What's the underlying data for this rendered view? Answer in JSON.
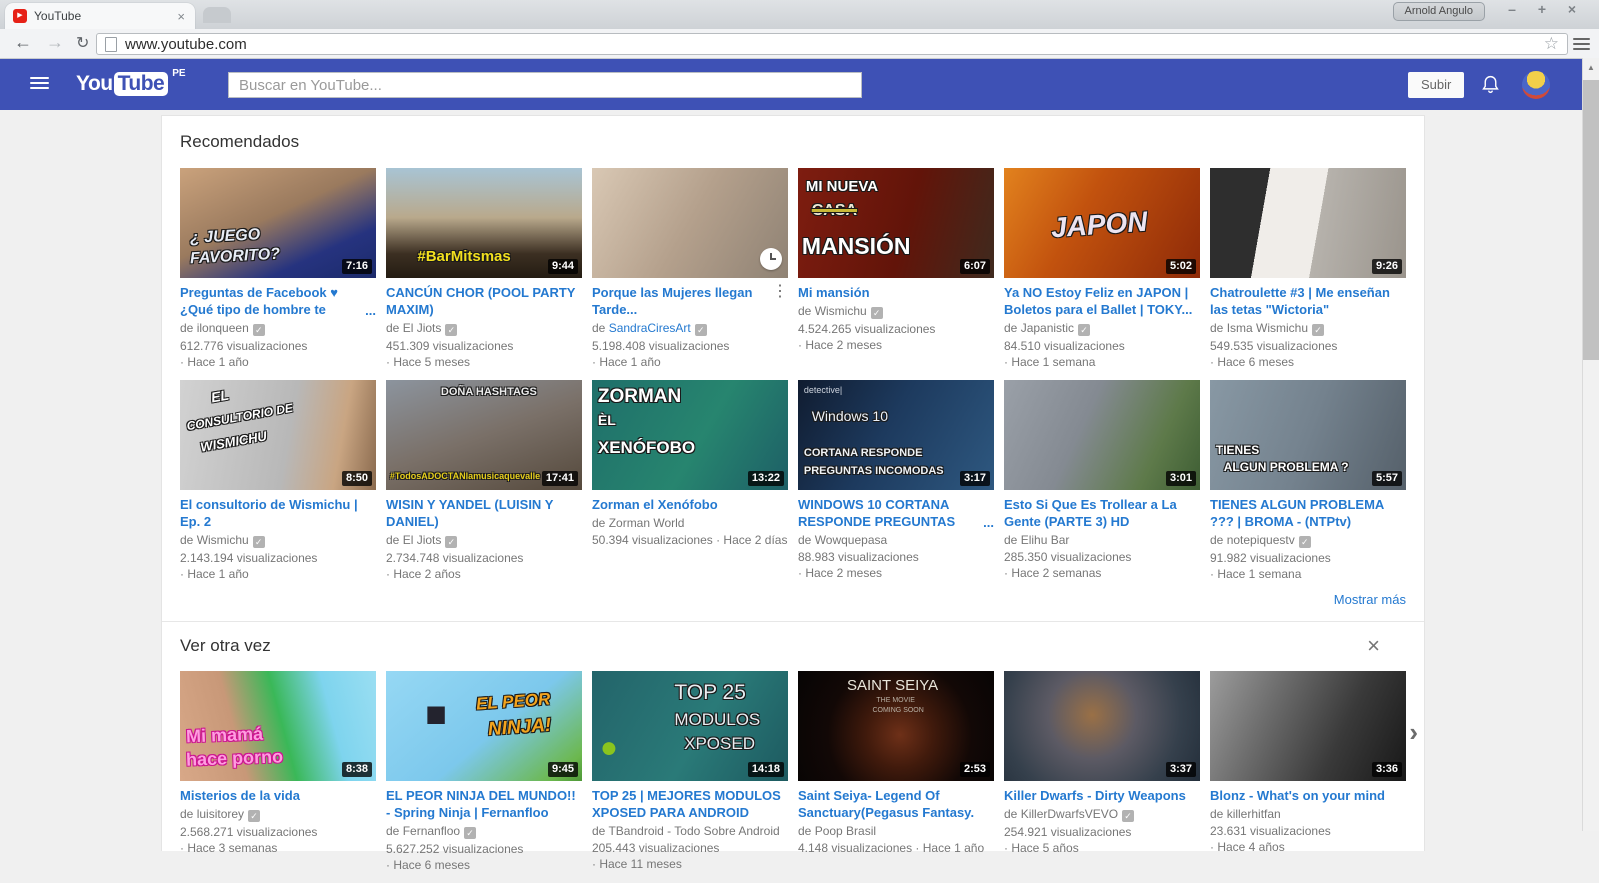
{
  "browser": {
    "tab_title": "YouTube",
    "url": "www.youtube.com",
    "profile_name": "Arnold Angulo"
  },
  "icons": {
    "play": "▶",
    "tab_close": "×",
    "win_min": "–",
    "win_max": "+",
    "win_close": "×",
    "back": "←",
    "forward": "→",
    "refresh": "↻",
    "star": "☆",
    "check": "✓",
    "dots_vertical": "⋮",
    "ellipsis": "...",
    "close": "×",
    "chevron_right": "›",
    "scroll_up": "▲"
  },
  "labels": {
    "by": "de"
  },
  "header": {
    "logo_you": "You",
    "logo_tube": "Tube",
    "country": "PE",
    "search_placeholder": "Buscar en YouTube...",
    "upload_label": "Subir"
  },
  "colors": {
    "header_blue": "#3e51b5",
    "link_blue": "#2479d0",
    "meta_gray": "#767676",
    "page_bg": "#f0f0f0"
  },
  "sections": [
    {
      "title": "Recomendados",
      "show_more": "Mostrar más",
      "videos": [
        {
          "title": "Preguntas de Facebook ♥ ¿Qué tipo de hombre te",
          "channel": "ilonqueen",
          "verified": true,
          "views": "612.776 visualizaciones",
          "age": "Hace 1 año",
          "duration": "7:16",
          "menu": "h",
          "thumb": {
            "bg": "linear-gradient(155deg,#caa27c 0%,#9a7a5e 45%,#26337f 75%,#1b2a6b 100%)",
            "ov": [
              [
                "¿ JUEGO",
                5,
                55,
                16,
                "#e8edf6",
                700,
                1,
                1,
                -3
              ],
              [
                "FAVORITO?",
                5,
                74,
                16,
                "#e8edf6",
                700,
                1,
                1,
                -3
              ]
            ]
          }
        },
        {
          "title": "CANCÚN CHOR (POOL PARTY MAXIM)",
          "channel": "El Jiots",
          "verified": true,
          "views": "451.309 visualizaciones",
          "age": "Hace 5 meses",
          "duration": "9:44",
          "thumb": {
            "bg": "linear-gradient(180deg,#a8c4d4 0%,#b9a98c 45%,#3c2f22 78%,#241c12 100%)",
            "ov": [
              [
                "#BarMitsmas",
                16,
                74,
                15,
                "#f2df1e",
                800,
                0,
                1,
                0
              ]
            ]
          }
        },
        {
          "title": "Porque las Mujeres llegan Tarde...",
          "channel": "SandraCiresArt",
          "verified": true,
          "hl": true,
          "views": "5.198.408 visualizaciones",
          "age": "Hace 1 año",
          "menu": "v",
          "watch_later": true,
          "thumb": {
            "bg": "linear-gradient(120deg,#d9c8b4 0%,#b4a08c 50%,#8f8274 100%)",
            "ov": []
          }
        },
        {
          "title": "Mi mansión",
          "channel": "Wismichu",
          "verified": true,
          "views": "4.524.265 visualizaciones",
          "age": "Hace 2 meses",
          "duration": "6:07",
          "thumb": {
            "bg": "linear-gradient(105deg,#7e1d10 0%,#621409 55%,#3f2a1e 100%)",
            "ov": [
              [
                "MI NUEVA",
                4,
                10,
                15,
                "#ffffff",
                800,
                0,
                1,
                0
              ],
              [
                "CASA",
                7,
                32,
                16,
                "#efe8d4",
                800,
                0,
                1,
                0,
                1
              ],
              [
                "MANSIÓN",
                2,
                60,
                23,
                "#ffffff",
                800,
                0,
                1,
                0
              ]
            ]
          }
        },
        {
          "title": "Ya NO Estoy Feliz en JAPON | Boletos para el Ballet | TOKY...",
          "channel": "Japanistic",
          "verified": true,
          "views": "84.510 visualizaciones",
          "age": "Hace 1 semana",
          "duration": "5:02",
          "thumb": {
            "bg": "linear-gradient(120deg,#e2821e 0%,#c2520e 40%,#8e2a08 100%)",
            "ov": [
              [
                "JAPON",
                24,
                38,
                28,
                "#ece4f0",
                800,
                1,
                1,
                -4
              ]
            ]
          }
        },
        {
          "title": "Chatroulette #3 | Me enseñan las tetas \"Wictoria\"",
          "channel": "Isma Wismichu",
          "verified": true,
          "views": "549.535 visualizaciones",
          "age": "Hace 6 meses",
          "duration": "9:26",
          "thumb": {
            "bg": "linear-gradient(100deg,#2e2e2e 0%,#2e2e2e 28%,#f0ede9 28%,#f0ede9 55%,#b6b2ac 55%,#9a948c 100%)",
            "ov": []
          }
        },
        {
          "title": "El consultorio de Wismichu | Ep. 2",
          "channel": "Wismichu",
          "verified": true,
          "views": "2.143.194 visualizaciones",
          "age": "Hace 1 año",
          "duration": "8:50",
          "thumb": {
            "bg": "linear-gradient(100deg,#d2d2d2 0%,#b8b8b8 55%,#c9a582 80%,#8a6a4e 100%)",
            "ov": [
              [
                "EL",
                16,
                8,
                14,
                "#ffffff",
                800,
                1,
                1,
                -10
              ],
              [
                "CONSULTORIO DE",
                3,
                28,
                12,
                "#ffffff",
                800,
                1,
                1,
                -10
              ],
              [
                "WISMICHU",
                10,
                50,
                13,
                "#ffffff",
                800,
                1,
                1,
                -10
              ]
            ]
          }
        },
        {
          "title": "WISIN Y YANDEL (LUISIN Y DANIEL)",
          "channel": "El Jiots",
          "verified": true,
          "views": "2.734.748 visualizaciones",
          "age": "Hace 2 años",
          "duration": "17:41",
          "thumb": {
            "bg": "linear-gradient(160deg,#8c949e 0%,#7a7068 50%,#55493c 100%)",
            "ov": [
              [
                "DOÑA HASHTAGS",
                28,
                6,
                11,
                "#ececec",
                800,
                0,
                1,
                0
              ],
              [
                "#TodosADOCTANlamusicaquevalle",
                2,
                84,
                9,
                "#e6ce1c",
                700,
                0,
                1,
                0
              ]
            ]
          }
        },
        {
          "title": "Zorman el Xenófobo",
          "channel": "Zorman World",
          "verified": false,
          "views": "50.394 visualizaciones",
          "age": "Hace 2 días",
          "duration": "13:22",
          "thumb": {
            "bg": "linear-gradient(120deg,#1f6f6a 0%,#27856f 55%,#1d5f66 100%)",
            "ov": [
              [
                "ZORMAN",
                3,
                6,
                19,
                "#ffffff",
                800,
                0,
                1,
                0
              ],
              [
                "ÈL",
                3,
                30,
                14,
                "#ffffff",
                800,
                0,
                1,
                0
              ],
              [
                "XENÓFOBO",
                3,
                54,
                17,
                "#ffffff",
                800,
                0,
                1,
                0
              ]
            ]
          }
        },
        {
          "title": "WINDOWS 10 CORTANA RESPONDE PREGUNTAS",
          "channel": "Wowquepasa",
          "verified": false,
          "views": "88.983 visualizaciones",
          "age": "Hace 2 meses",
          "duration": "3:17",
          "menu": "h",
          "thumb": {
            "bg": "linear-gradient(120deg,#101c30 0%,#1d3a5e 45%,#2e5880 100%)",
            "ov": [
              [
                "detective|",
                3,
                5,
                9,
                "#cdd3dd",
                400,
                0,
                0,
                0
              ],
              [
                "Windows 10",
                7,
                26,
                14,
                "#eef2f8",
                400,
                0,
                1,
                0
              ],
              [
                "CORTANA RESPONDE",
                3,
                62,
                11,
                "#eef2f6",
                800,
                0,
                1,
                0
              ],
              [
                "PREGUNTAS INCOMODAS",
                3,
                78,
                11,
                "#eef2f6",
                800,
                0,
                1,
                0
              ]
            ]
          }
        },
        {
          "title": "Esto Si Que Es Trollear a La Gente (PARTE 3) HD",
          "channel": "Elihu Bar",
          "verified": false,
          "views": "285.350 visualizaciones",
          "age": "Hace 2 semanas",
          "duration": "3:01",
          "thumb": {
            "bg": "linear-gradient(115deg,#9aa0a8 0%,#848a92 40%,#5e7a4a 75%,#3e5e34 100%)",
            "ov": []
          }
        },
        {
          "title": "TIENES ALGUN PROBLEMA ??? | BROMA - (NTPtv)",
          "channel": "notepiquestv",
          "verified": true,
          "views": "91.982 visualizaciones",
          "age": "Hace 1 semana",
          "duration": "5:57",
          "thumb": {
            "bg": "linear-gradient(110deg,#8898a4 0%,#74828e 50%,#55606a 100%)",
            "ov": [
              [
                "TIENES",
                3,
                58,
                12,
                "#ffffff",
                800,
                0,
                1,
                0
              ],
              [
                "ALGUN PROBLEMA ?",
                7,
                74,
                12,
                "#ffffff",
                800,
                0,
                1,
                0
              ]
            ]
          }
        }
      ]
    },
    {
      "title": "Ver otra vez",
      "videos": [
        {
          "title": "Misterios de la vida",
          "channel": "luisitorey",
          "verified": true,
          "views": "2.568.271 visualizaciones",
          "age": "Hace 3 semanas",
          "duration": "8:38",
          "thumb": {
            "bg": "linear-gradient(75deg,#d8a888 0%,#c89878 30%,#3ab858 52%,#7ed4ee 75%,#9adef2 100%)",
            "ov": [
              [
                "Mi mamá",
                3,
                50,
                18,
                "#ff9ce0",
                800,
                0,
                "#cc1690",
                -2
              ],
              [
                "hace porno",
                3,
                71,
                18,
                "#ff9ce0",
                800,
                0,
                "#cc1690",
                -2
              ]
            ]
          }
        },
        {
          "title": "EL PEOR NINJA DEL MUNDO!! - Spring Ninja | Fernanfloo",
          "channel": "Fernanfloo",
          "verified": true,
          "views": "5.627.252 visualizaciones",
          "age": "Hace 6 meses",
          "duration": "9:45",
          "thumb": {
            "bg": "linear-gradient(140deg,#96d8f4 0%,#7cc8ec 55%,#6cb84e 90%,#4e9838 100%)",
            "ov": [
              [
                "■",
                20,
                22,
                36,
                "#23232e",
                400,
                0,
                0,
                0
              ],
              [
                "EL PEOR",
                46,
                20,
                17,
                "#f2a41e",
                800,
                1,
                1,
                -4
              ],
              [
                "NINJA!",
                52,
                43,
                19,
                "#f2a41e",
                800,
                1,
                1,
                -4
              ]
            ]
          }
        },
        {
          "title": "TOP 25 | MEJORES MODULOS XPOSED PARA ANDROID",
          "channel": "TBandroid - Todo Sobre Android",
          "verified": false,
          "views": "205.443 visualizaciones",
          "age": "Hace 11 meses",
          "duration": "14:18",
          "thumb": {
            "bg": "linear-gradient(120deg,#23646a 0%,#2a7a78 55%,#1d5a60 100%)",
            "ov": [
              [
                "●",
                4,
                55,
                30,
                "#8ac41e",
                400,
                0,
                0,
                0
              ],
              [
                "TOP 25",
                42,
                10,
                21,
                "#e9edf1",
                400,
                0,
                1,
                0
              ],
              [
                "MODULOS",
                42,
                36,
                17,
                "#e9edf1",
                400,
                0,
                1,
                0
              ],
              [
                "XPOSED",
                47,
                58,
                17,
                "#e9edf1",
                400,
                0,
                1,
                0
              ]
            ]
          }
        },
        {
          "title": "Saint Seiya- Legend Of Sanctuary(Pegasus Fantasy.",
          "channel": "Poop Brasil",
          "verified": false,
          "views": "4.148 visualizaciones",
          "age": "Hace 1 año",
          "duration": "2:53",
          "thumb": {
            "bg": "radial-gradient(circle at 52% 58%,#6e3018 0%,#401a0c 28%,#120806 60%,#060404 100%)",
            "ov": [
              [
                "SAINT SEIYA",
                25,
                6,
                15,
                "#e9e5da",
                400,
                0,
                0,
                0
              ],
              [
                "THE MOVIE",
                40,
                24,
                7,
                "#b9b1a5",
                400,
                0,
                0,
                0
              ],
              [
                "COMING SOON",
                38,
                33,
                7,
                "#b9b1a5",
                400,
                0,
                0,
                0
              ]
            ]
          }
        },
        {
          "title": "Killer Dwarfs - Dirty Weapons",
          "channel": "KillerDwarfsVEVO",
          "verified": true,
          "views": "254.921 visualizaciones",
          "age": "Hace 5 años",
          "duration": "3:37",
          "thumb": {
            "bg": "radial-gradient(circle at 45% 40%,#9a7046 0%,#5c5a64 35%,#35404c 70%,#232e3a 100%)",
            "ov": []
          }
        },
        {
          "title": "Blonz - What's on your mind",
          "channel": "killerhitfan",
          "verified": false,
          "views": "23.631 visualizaciones",
          "age": "Hace 4 años",
          "duration": "3:36",
          "thumb": {
            "bg": "linear-gradient(115deg,#9c9c9c 0%,#6e6e6e 30%,#3a3a3a 65%,#181818 100%)",
            "ov": []
          }
        }
      ]
    }
  ]
}
